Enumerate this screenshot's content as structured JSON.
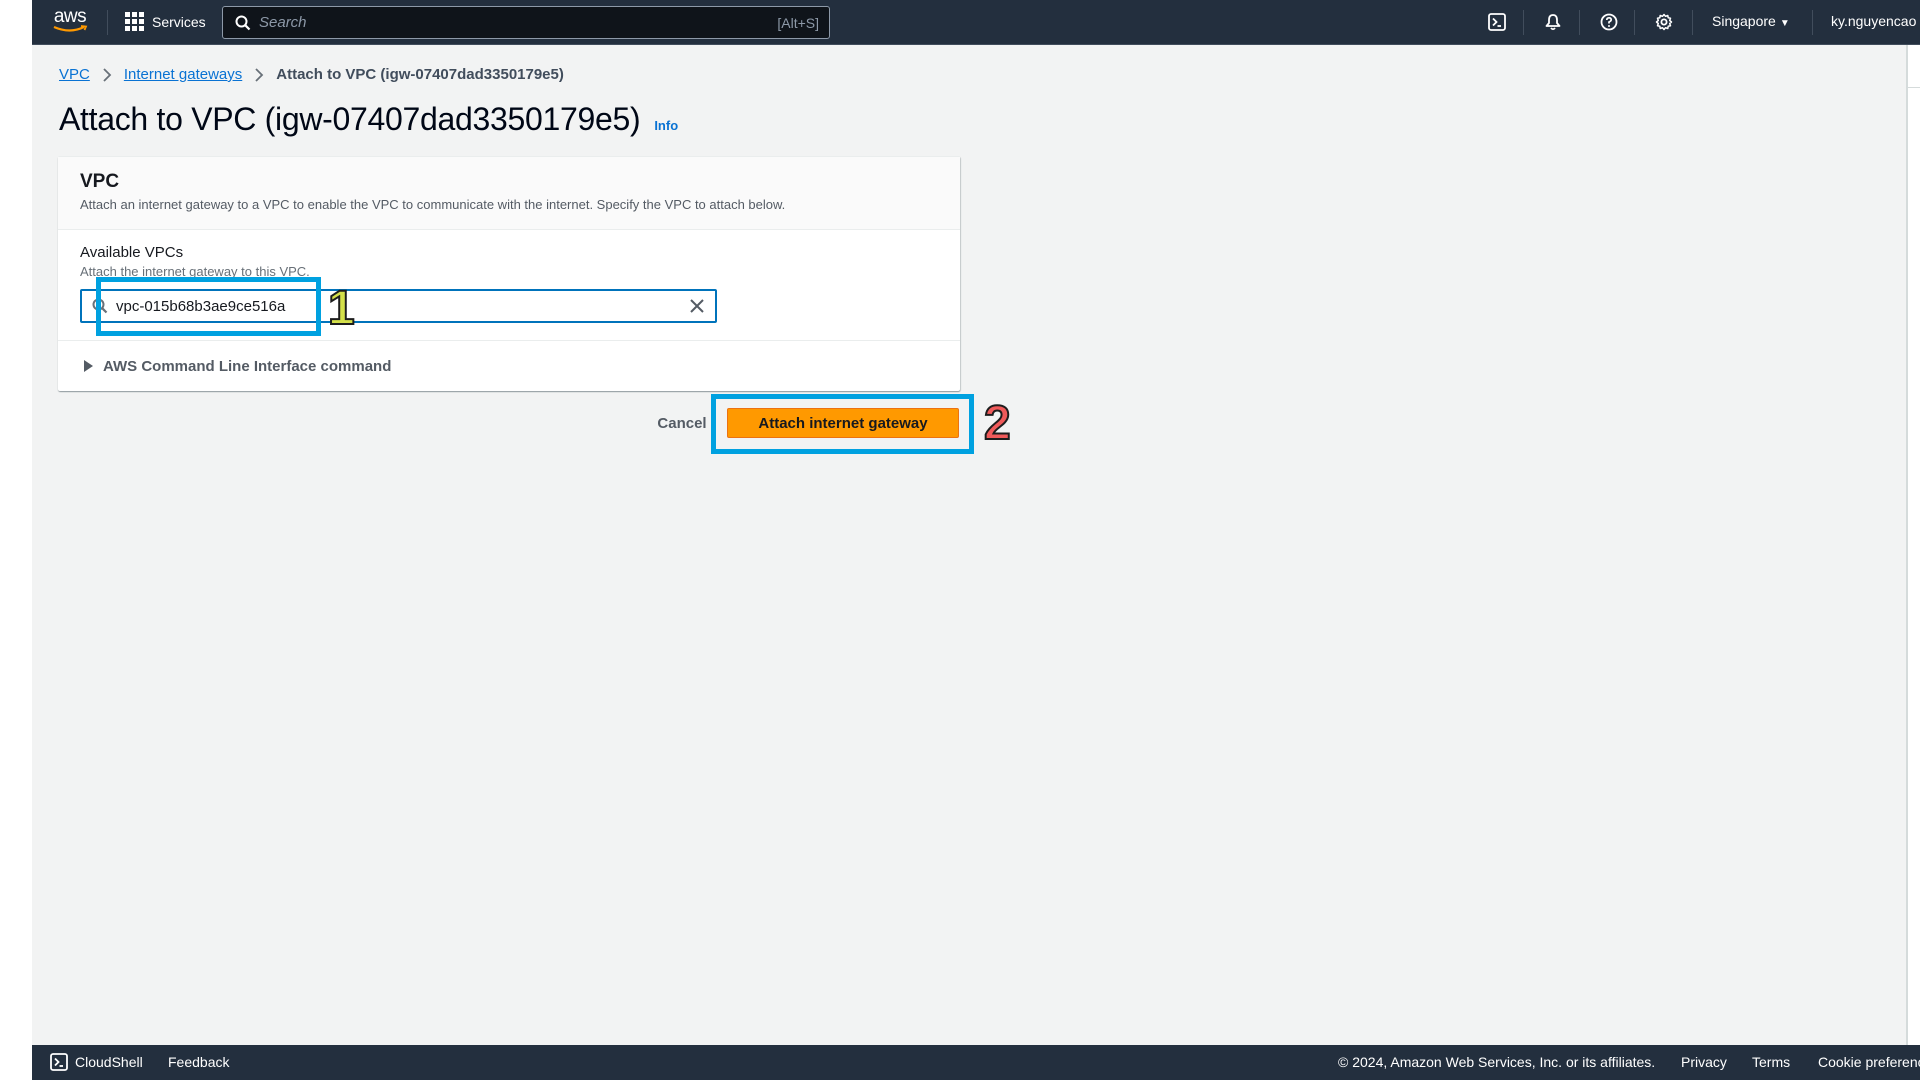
{
  "topnav": {
    "logo_text": "aws",
    "services_label": "Services",
    "search_placeholder": "Search",
    "search_shortcut": "[Alt+S]",
    "icons": [
      "cloudshell-icon",
      "notifications-bell-icon",
      "help-icon",
      "settings-gear-icon"
    ],
    "region_label": "Singapore",
    "user_label": "ky.nguyencao"
  },
  "breadcrumb": {
    "items": [
      {
        "label": "VPC",
        "link": true
      },
      {
        "label": "Internet gateways",
        "link": true
      },
      {
        "label": "Attach to VPC (igw-07407dad3350179e5)",
        "link": false
      }
    ]
  },
  "page": {
    "title": "Attach to VPC (igw-07407dad3350179e5)",
    "info_label": "Info"
  },
  "panel": {
    "title": "VPC",
    "description": "Attach an internet gateway to a VPC to enable the VPC to communicate with the internet. Specify the VPC to attach below.",
    "field_label": "Available VPCs",
    "field_description": "Attach the internet gateway to this VPC.",
    "vpc_value": "vpc-015b68b3ae9ce516a",
    "cli_label": "AWS Command Line Interface command"
  },
  "actions": {
    "cancel_label": "Cancel",
    "attach_label": "Attach internet gateway"
  },
  "annotations": {
    "step1": "1",
    "step2": "2",
    "box_color": "#00a1e0"
  },
  "footer": {
    "cloudshell_label": "CloudShell",
    "feedback_label": "Feedback",
    "copyright": "© 2024, Amazon Web Services, Inc. or its affiliates.",
    "privacy_label": "Privacy",
    "terms_label": "Terms",
    "cookie_label": "Cookie preferences"
  }
}
